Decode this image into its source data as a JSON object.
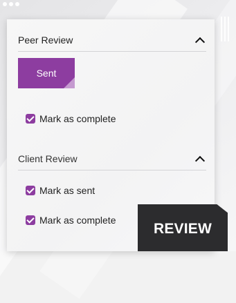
{
  "peer_review": {
    "title": "Peer Review",
    "toggle_icon": "chevron-up-icon",
    "sent_button_label": "Sent",
    "mark_complete_label": "Mark as complete",
    "mark_complete_checked": true
  },
  "client_review": {
    "title": "Client Review",
    "toggle_icon": "chevron-up-icon",
    "mark_sent_label": "Mark as sent",
    "mark_sent_checked": true,
    "mark_complete_label": "Mark as complete",
    "mark_complete_checked": true
  },
  "badge": {
    "label": "REVIEW"
  },
  "colors": {
    "accent": "#8d3da0",
    "badge_bg": "#2c2c2e",
    "panel_bg": "#f5f5f6"
  }
}
